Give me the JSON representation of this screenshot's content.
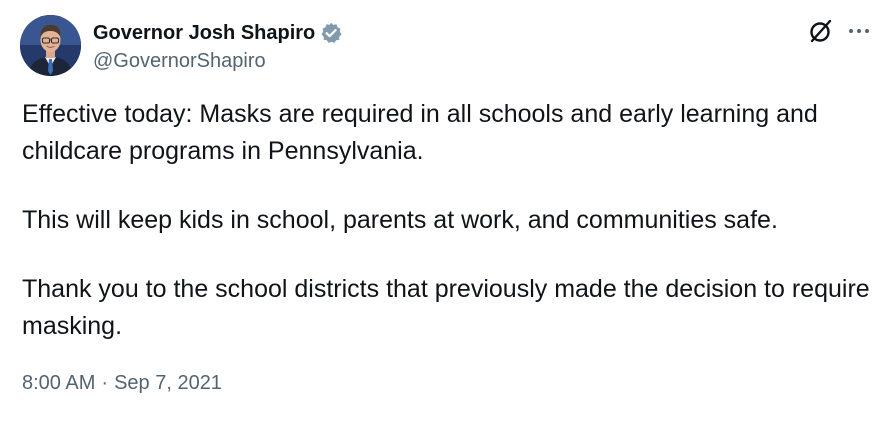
{
  "author": {
    "display_name": "Governor Josh Shapiro",
    "handle": "@GovernorShapiro",
    "verified_badge_icon": "verified-badge-icon",
    "badge_color": "#829aab"
  },
  "actions": {
    "grok_icon": "grok-icon",
    "more_icon": "more-options-icon"
  },
  "tweet": {
    "paragraphs": [
      "Effective today: Masks are required in all schools and early learning and childcare programs in Pennsylvania.",
      "This will keep kids in school, parents at work, and communities safe.",
      "Thank you to the school districts that previously made the decision to require masking."
    ],
    "time": "8:00 AM",
    "separator": "·",
    "date": "Sep 7, 2021"
  },
  "colors": {
    "text_primary": "#0f1419",
    "text_secondary": "#536471",
    "background": "#ffffff"
  }
}
